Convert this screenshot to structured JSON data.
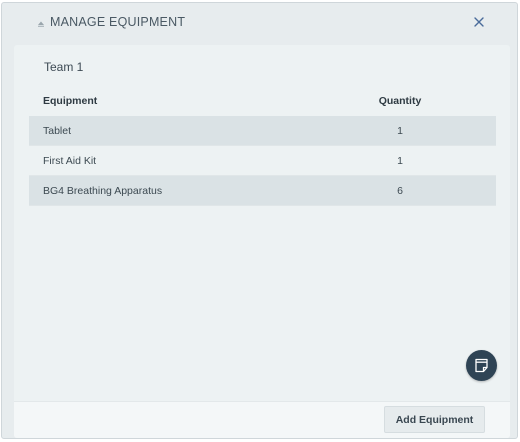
{
  "dialog": {
    "title": "MANAGE EQUIPMENT",
    "collapse_icon": "caret-up-icon",
    "close_icon": "close-icon"
  },
  "team": {
    "name": "Team 1"
  },
  "table": {
    "headers": {
      "equipment": "Equipment",
      "quantity": "Quantity"
    },
    "rows": [
      {
        "equipment": "Tablet",
        "quantity": "1"
      },
      {
        "equipment": "First Aid Kit",
        "quantity": "1"
      },
      {
        "equipment": "BG4 Breathing Apparatus",
        "quantity": "6"
      }
    ]
  },
  "fab": {
    "icon": "notes-icon"
  },
  "footer": {
    "add_button_label": "Add Equipment"
  },
  "colors": {
    "dialog_background": "#e7ecee",
    "panel_background": "#edf2f3",
    "row_shade": "#dae2e5",
    "fab_background": "#2f4455",
    "close_icon": "#4a6b9a"
  }
}
